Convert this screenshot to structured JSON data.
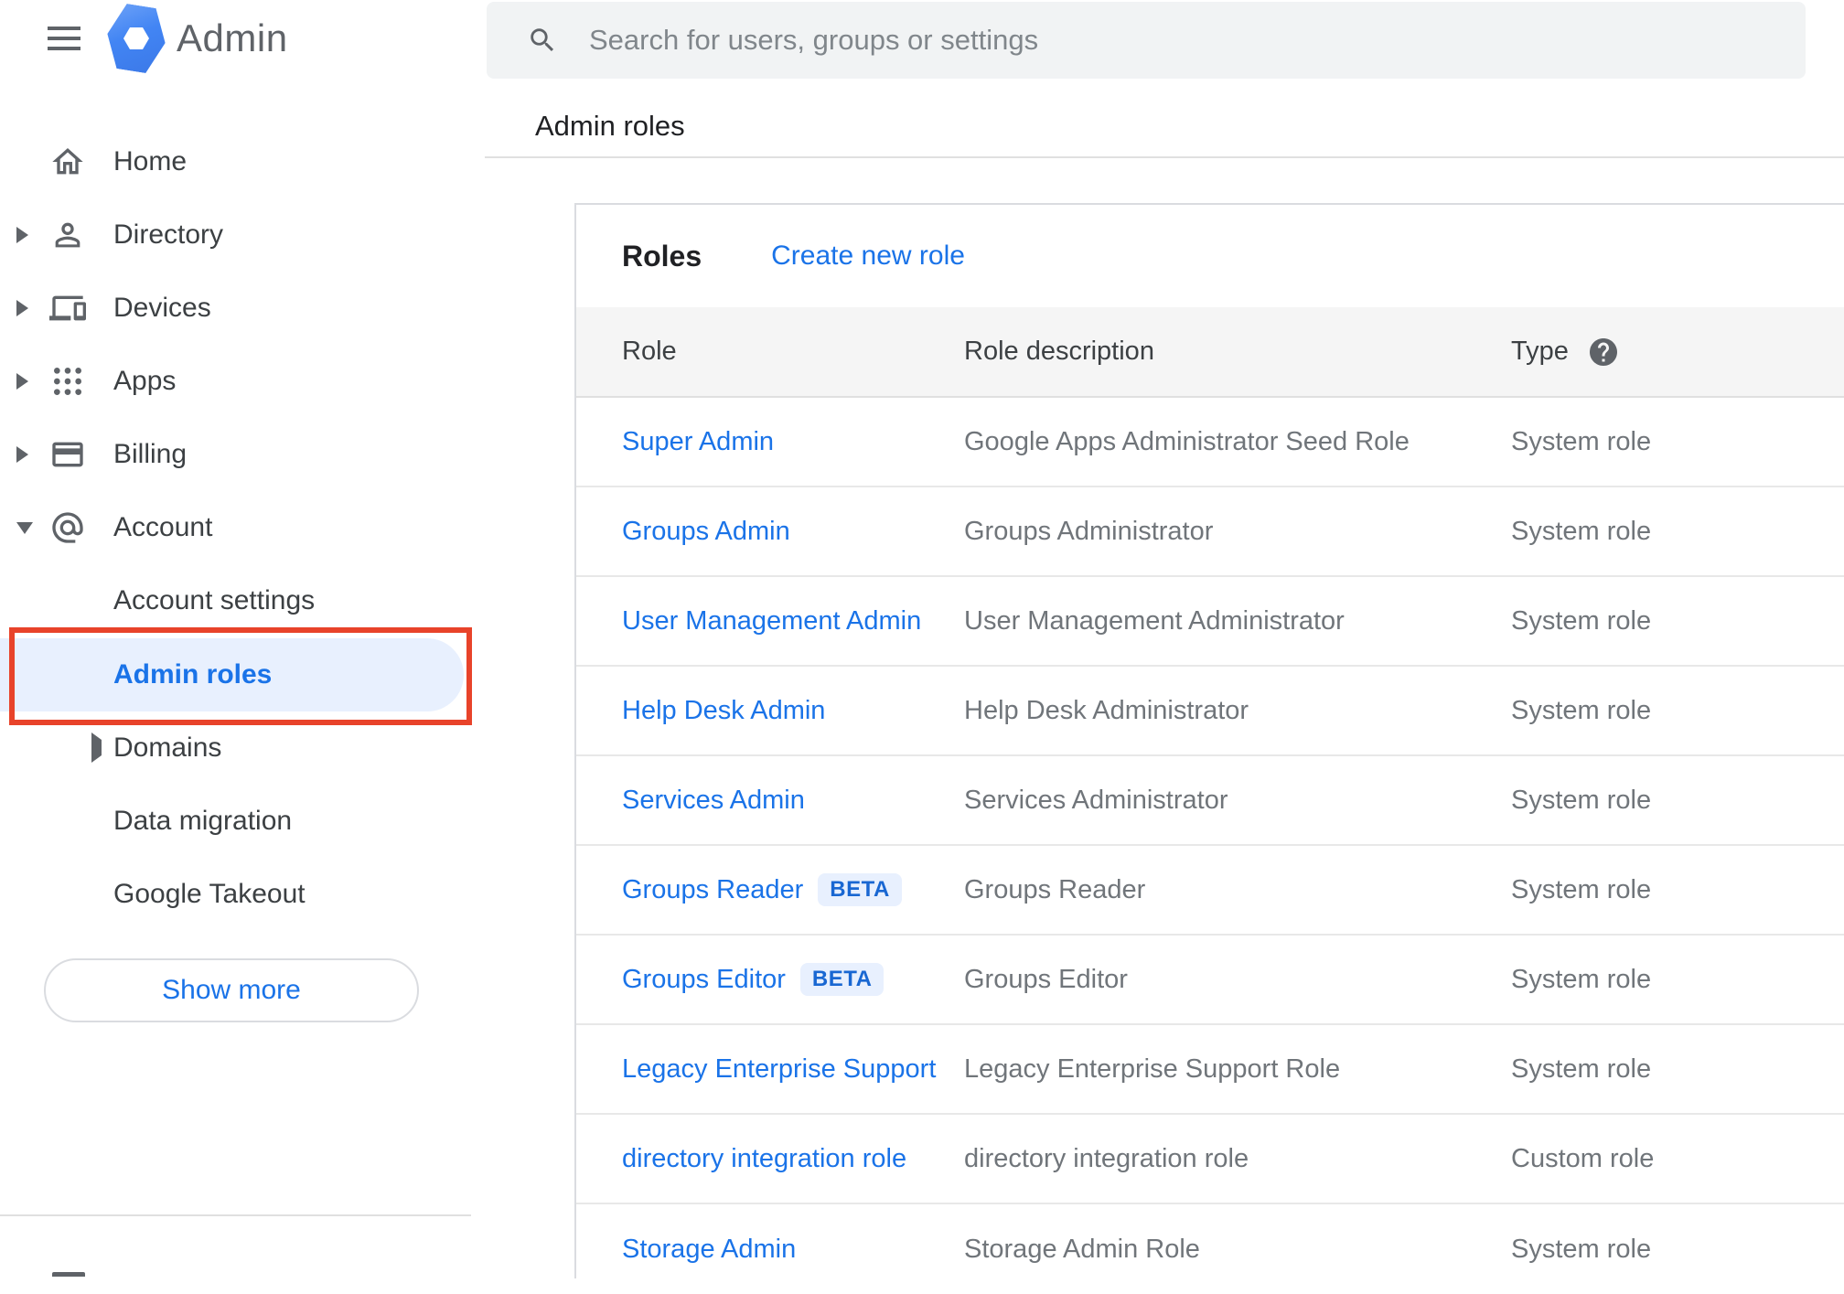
{
  "brand": {
    "app_name": "Admin"
  },
  "topbar": {
    "search_placeholder": "Search for users, groups or settings",
    "breadcrumb": "Admin roles"
  },
  "sidebar": {
    "items": [
      {
        "label": "Home",
        "icon": "home-icon",
        "expandable": false
      },
      {
        "label": "Directory",
        "icon": "person-icon",
        "expandable": true
      },
      {
        "label": "Devices",
        "icon": "devices-icon",
        "expandable": true
      },
      {
        "label": "Apps",
        "icon": "apps-grid-icon",
        "expandable": true
      },
      {
        "label": "Billing",
        "icon": "credit-card-icon",
        "expandable": true
      },
      {
        "label": "Account",
        "icon": "at-sign-icon",
        "expandable": true,
        "expanded": true
      }
    ],
    "account_children": [
      {
        "label": "Account settings",
        "selected": false
      },
      {
        "label": "Admin roles",
        "selected": true,
        "highlighted_by_annotation": true
      },
      {
        "label": "Domains",
        "selected": false,
        "expandable": true
      },
      {
        "label": "Data migration",
        "selected": false
      },
      {
        "label": "Google Takeout",
        "selected": false
      }
    ],
    "show_more_label": "Show more"
  },
  "main": {
    "title": "Roles",
    "create_link_label": "Create new role",
    "columns": {
      "role": "Role",
      "description": "Role description",
      "type": "Type"
    },
    "type_help_icon": "help-circle-icon",
    "rows": [
      {
        "role": "Super Admin",
        "description": "Google Apps Administrator Seed Role",
        "type": "System role"
      },
      {
        "role": "Groups Admin",
        "description": "Groups Administrator",
        "type": "System role"
      },
      {
        "role": "User Management Admin",
        "description": "User Management Administrator",
        "type": "System role"
      },
      {
        "role": "Help Desk Admin",
        "description": "Help Desk Administrator",
        "type": "System role"
      },
      {
        "role": "Services Admin",
        "description": "Services Administrator",
        "type": "System role"
      },
      {
        "role": "Groups Reader",
        "beta_label": "BETA",
        "description": "Groups Reader",
        "type": "System role"
      },
      {
        "role": "Groups Editor",
        "beta_label": "BETA",
        "description": "Groups Editor",
        "type": "System role"
      },
      {
        "role": "Legacy Enterprise Support",
        "description": "Legacy Enterprise Support Role",
        "type": "System role"
      },
      {
        "role": "directory integration role",
        "description": "directory integration role",
        "type": "Custom role"
      },
      {
        "role": "Storage Admin",
        "description": "Storage Admin Role",
        "type": "System role"
      }
    ]
  },
  "colors": {
    "accent_blue": "#1a73e8",
    "selected_pill_bg": "#e8f0fe",
    "annotation_red": "#e8432a",
    "beta_badge_bg": "#e8f0fe",
    "beta_badge_text": "#1967d2",
    "table_header_bg": "#f5f5f5",
    "muted_text": "#70757a",
    "icon_gray": "#5f6368"
  }
}
